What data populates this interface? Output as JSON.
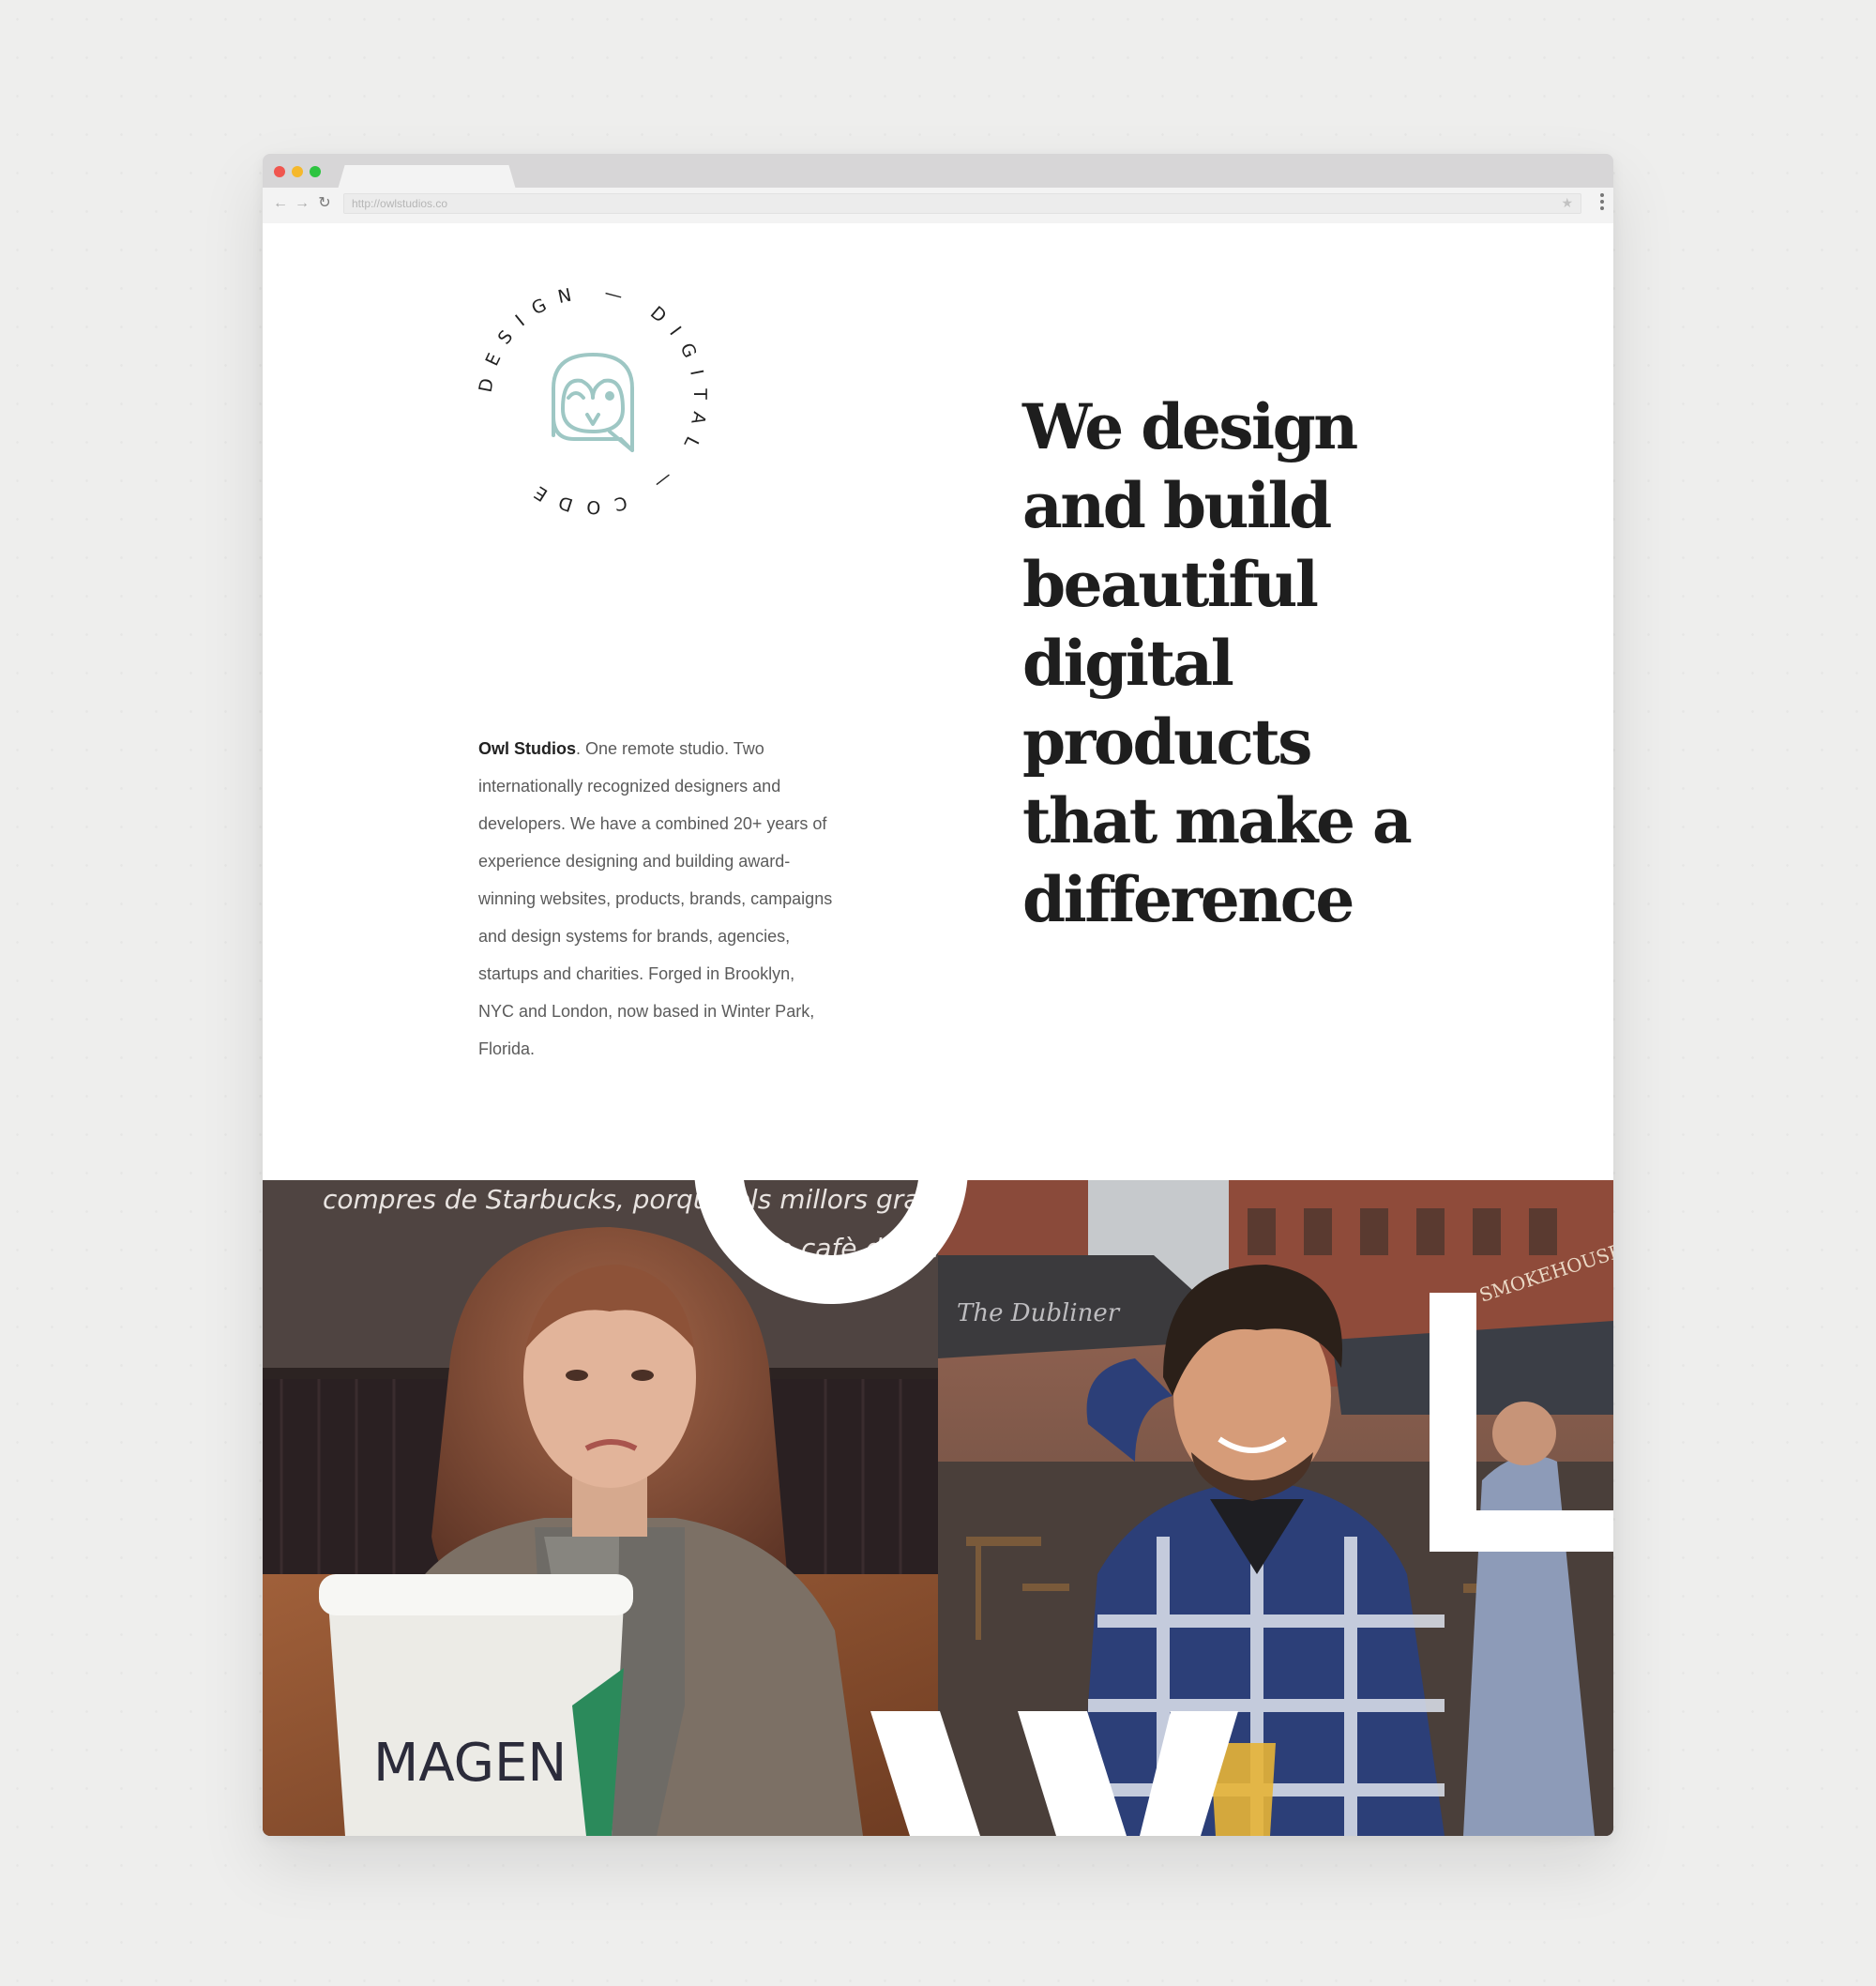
{
  "browser": {
    "url": "http://owlstudios.co"
  },
  "logo": {
    "ring_text": "DESIGN — DIGITAL — CODE"
  },
  "intro": {
    "brand": "Owl Studios",
    "body": ". One remote studio. Two internationally recognized designers and developers. We have a combined 20+ years of experience designing and building award-winning websites, products, brands, campaigns and design systems for brands, agencies, startups and charities. Forged in Brooklyn, NYC and London, now based in Winter Park, Florida."
  },
  "headline": {
    "lines": [
      "We design",
      "and build",
      "beautiful",
      "digital",
      "products",
      "that make a",
      "difference"
    ]
  },
  "photos": {
    "left": {
      "chalkboard_line1": "compres de Starbucks, porque els millors grans",
      "chalkboard_line2": "de cafè del m",
      "cup_name": "MAGEN"
    },
    "right": {
      "awning_text": "The Dubliner",
      "sign_text": "SMOKEHOUSE"
    }
  },
  "colors": {
    "owl_accent": "#9ec7c4",
    "headline": "#1e1e1e",
    "body": "#5b5b5b"
  }
}
